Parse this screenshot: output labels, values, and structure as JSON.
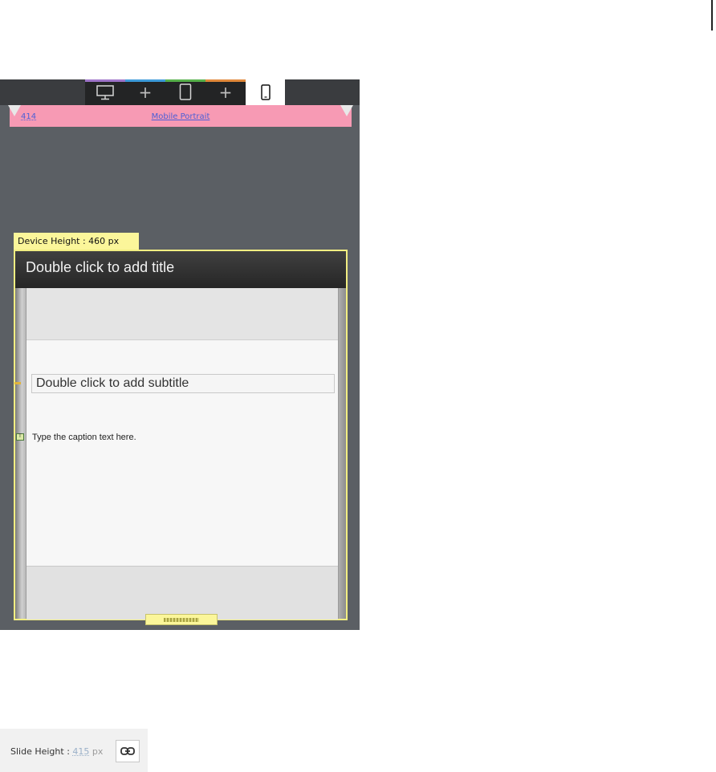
{
  "tabs": [
    {
      "id": "desktop",
      "icon": "desktop-icon",
      "strip_color": "#9e74c9"
    },
    {
      "id": "add-breakpoint-1",
      "label": "+",
      "strip_color": "#3c9ad9"
    },
    {
      "id": "tablet",
      "icon": "tablet-icon",
      "strip_color": "#56b04a"
    },
    {
      "id": "add-breakpoint-2",
      "label": "+",
      "strip_color": "#e0883a"
    },
    {
      "id": "mobile",
      "icon": "mobile-icon",
      "strip_color": "#ffffff",
      "selected": true
    }
  ],
  "ruler": {
    "width_value": "414",
    "breakpoint_name": "Mobile Portrait",
    "color": "#f79ab4"
  },
  "device": {
    "height_label": "Device Height : 460 px"
  },
  "slide": {
    "title_placeholder": "Double click to add title",
    "subtitle_placeholder": "Double click to add subtitle",
    "caption_placeholder": "Type the caption text here."
  },
  "slide_height": {
    "label": "Slide Height :",
    "value": "415",
    "unit": "px",
    "link_icon": "link-icon"
  }
}
